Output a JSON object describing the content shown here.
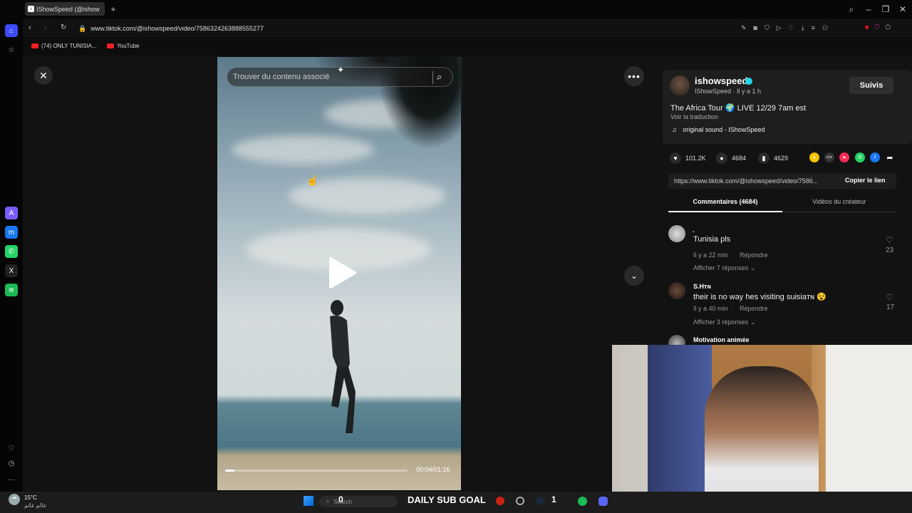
{
  "browser": {
    "tab_title": "IShowSpeed (@ishow",
    "url": "www.tiktok.com/@ishowspeed/video/7586324263888555277",
    "bookmarks": [
      {
        "label": "(74) ONLY TUNISIA..."
      },
      {
        "label": "YouTube"
      }
    ]
  },
  "video": {
    "search_placeholder": "Trouver du contenu associé",
    "time": "00:04/01:16",
    "progress": 0.05
  },
  "creator": {
    "username": "ishowspeed",
    "subline": "IShowSpeed · Il y a 1 h",
    "follow_label": "Suivis"
  },
  "post": {
    "description": "The Africa Tour 🌍 LIVE 12/29 7am est",
    "translate": "Voir la traduction",
    "sound": "original sound - IShowSpeed"
  },
  "stats": {
    "likes": "101.2K",
    "comments": "4684",
    "saves": "4629"
  },
  "link": {
    "url": "https://www.tiktok.com/@ishowspeed/video/7586...",
    "copy_label": "Copier le lien"
  },
  "tabs": {
    "comments": "Commentaires (4684)",
    "videos": "Vidéos du créateur"
  },
  "comments": [
    {
      "name": ".",
      "text": "Tunisia pls",
      "time": "Il y a 22 min",
      "reply": "Répondre",
      "more": "Afficher 7 réponses",
      "likes": "23"
    },
    {
      "name": "S.Hᴛɴ",
      "text": "their is no way hes visiting suisiaᴛɴ 😵",
      "time": "Il y a 40 min",
      "reply": "Répondre",
      "more": "Afficher 3 réponses",
      "likes": "17"
    },
    {
      "name": "Motivation animée"
    }
  ],
  "taskbar": {
    "temp": "15°C",
    "weather_sub": "عالم غائم",
    "search": "Search",
    "sub_goal": "DAILY SUB GOAL",
    "count_left": "0",
    "count_right": "1"
  },
  "colors": {
    "verified": "#20d5ec",
    "accent": "#fe2c55"
  }
}
